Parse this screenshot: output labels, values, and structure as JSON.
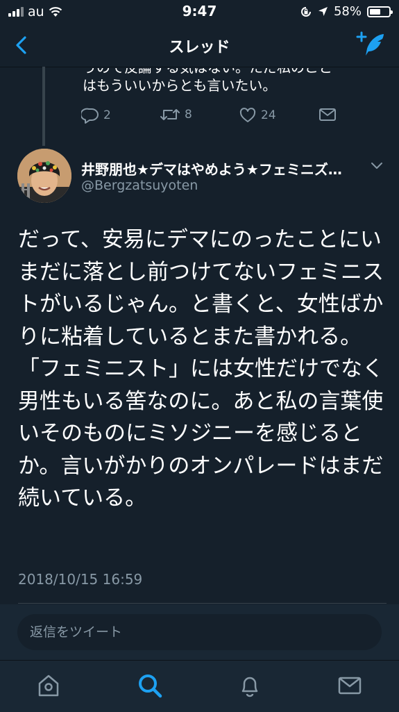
{
  "status_bar": {
    "carrier": "au",
    "time": "9:47",
    "battery_percent": "58%",
    "battery_level": 0.58
  },
  "nav": {
    "title": "スレッド"
  },
  "previous_tweet": {
    "partial_line": "うので反論する気はない。ただ私のこと",
    "text": "はもういいからとも言いたい。",
    "replies": "2",
    "retweets": "8",
    "likes": "24"
  },
  "tweet": {
    "name": "井野朋也★デマはやめよう★フェミニズ…",
    "handle": "@Bergzatsuyoten",
    "text": "だって、安易にデマにのったことにいまだに落とし前つけてないフェミニストがいるじゃん。と書くと、女性ばかりに粘着しているとまた書かれる。「フェミニスト」には女性だけでなく男性もいる筈なのに。あと私の言葉使いそのものにミソジニーを感じるとか。言いがかりのオンパレードはまだ続いている。",
    "timestamp": "2018/10/15 16:59"
  },
  "reply": {
    "placeholder": "返信をツイート"
  },
  "colors": {
    "background": "#15202b",
    "accent": "#1da1f2",
    "secondary_text": "#8899a6",
    "bar_background": "#192734"
  }
}
